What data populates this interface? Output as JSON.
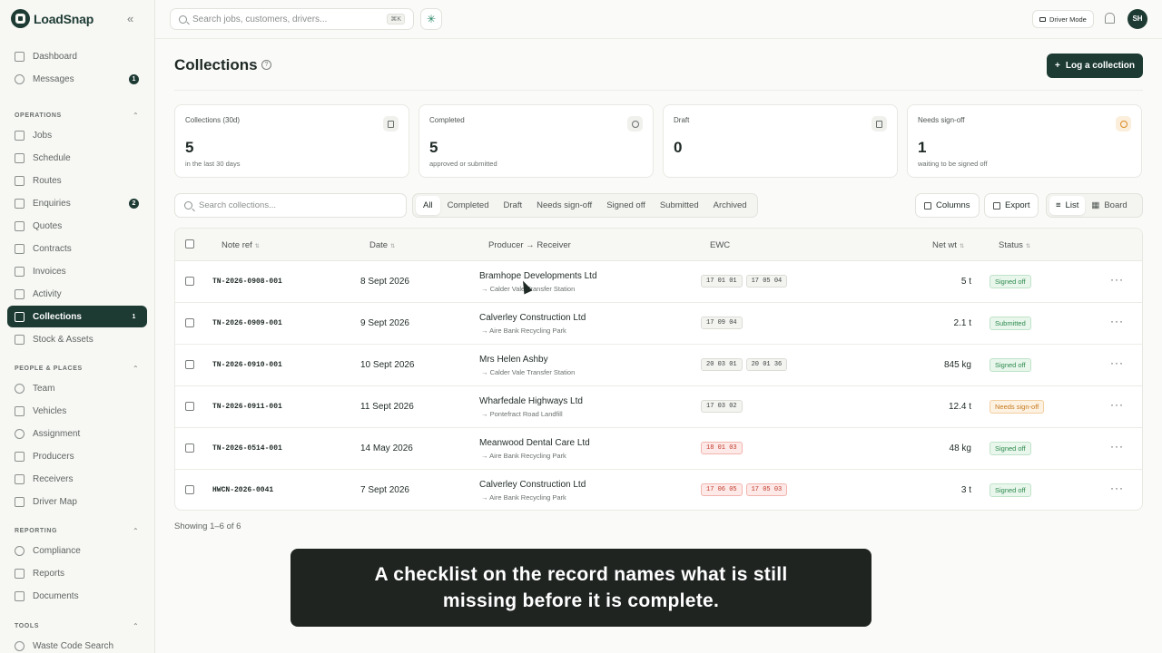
{
  "brand": {
    "name": "LoadSnap"
  },
  "sidebar": {
    "top": [
      {
        "label": "Dashboard"
      },
      {
        "label": "Messages",
        "badge": "1"
      }
    ],
    "sections": [
      {
        "title": "OPERATIONS",
        "items": [
          {
            "label": "Jobs"
          },
          {
            "label": "Schedule"
          },
          {
            "label": "Routes"
          },
          {
            "label": "Enquiries",
            "badge": "2"
          },
          {
            "label": "Quotes"
          },
          {
            "label": "Contracts"
          },
          {
            "label": "Invoices"
          },
          {
            "label": "Activity"
          },
          {
            "label": "Collections",
            "badge": "1",
            "active": true
          },
          {
            "label": "Stock & Assets"
          }
        ]
      },
      {
        "title": "PEOPLE & PLACES",
        "items": [
          {
            "label": "Team"
          },
          {
            "label": "Vehicles"
          },
          {
            "label": "Assignment"
          },
          {
            "label": "Producers"
          },
          {
            "label": "Receivers"
          },
          {
            "label": "Driver Map"
          }
        ]
      },
      {
        "title": "REPORTING",
        "items": [
          {
            "label": "Compliance"
          },
          {
            "label": "Reports"
          },
          {
            "label": "Documents"
          }
        ]
      },
      {
        "title": "TOOLS",
        "items": [
          {
            "label": "Waste Code Search"
          }
        ]
      }
    ]
  },
  "topbar": {
    "search_placeholder": "Search jobs, customers, drivers...",
    "shortcut": "⌘K",
    "driver_mode": "Driver Mode",
    "avatar": "SH"
  },
  "page": {
    "title": "Collections",
    "primary_action": "Log a collection",
    "showing": "Showing 1–6 of 6"
  },
  "stats": [
    {
      "label": "Collections (30d)",
      "value": "5",
      "sub": "in the last 30 days",
      "icon": "document-icon"
    },
    {
      "label": "Completed",
      "value": "5",
      "sub": "approved or submitted",
      "icon": "check-circle-icon"
    },
    {
      "label": "Draft",
      "value": "0",
      "sub": "",
      "icon": "document-icon"
    },
    {
      "label": "Needs sign-off",
      "value": "1",
      "sub": "waiting to be signed off",
      "icon": "clock-icon"
    }
  ],
  "toolbar": {
    "search_placeholder": "Search collections...",
    "filters": [
      "All",
      "Completed",
      "Draft",
      "Needs sign-off",
      "Signed off",
      "Submitted",
      "Archived"
    ],
    "active_filter": "All",
    "columns": "Columns",
    "export": "Export",
    "views": [
      "List",
      "Board"
    ],
    "active_view": "List"
  },
  "table": {
    "headers": {
      "ref": "Note ref",
      "date": "Date",
      "party": "Producer → Receiver",
      "ewc": "EWC",
      "netwt": "Net wt",
      "status": "Status"
    },
    "rows": [
      {
        "ref": "TN-2026-0908-001",
        "date": "8 Sept 2026",
        "producer": "Bramhope Developments Ltd",
        "receiver": "Calder Vale Transfer Station",
        "ewc": [
          {
            "code": "17 01 01"
          },
          {
            "code": "17 05 04"
          }
        ],
        "netwt": "5 t",
        "status": "Signed off",
        "status_type": "signed"
      },
      {
        "ref": "TN-2026-0909-001",
        "date": "9 Sept 2026",
        "producer": "Calverley Construction Ltd",
        "receiver": "Aire Bank Recycling Park",
        "ewc": [
          {
            "code": "17 09 04"
          }
        ],
        "netwt": "2.1 t",
        "status": "Submitted",
        "status_type": "submitted"
      },
      {
        "ref": "TN-2026-0910-001",
        "date": "10 Sept 2026",
        "producer": "Mrs Helen Ashby",
        "receiver": "Calder Vale Transfer Station",
        "ewc": [
          {
            "code": "20 03 01"
          },
          {
            "code": "20 01 36"
          }
        ],
        "netwt": "845 kg",
        "status": "Signed off",
        "status_type": "signed"
      },
      {
        "ref": "TN-2026-0911-001",
        "date": "11 Sept 2026",
        "producer": "Wharfedale Highways Ltd",
        "receiver": "Pontefract Road Landfill",
        "ewc": [
          {
            "code": "17 03 02"
          }
        ],
        "netwt": "12.4 t",
        "status": "Needs sign-off",
        "status_type": "needs"
      },
      {
        "ref": "TN-2026-0514-001",
        "date": "14 May 2026",
        "producer": "Meanwood Dental Care Ltd",
        "receiver": "Aire Bank Recycling Park",
        "ewc": [
          {
            "code": "18 01 03",
            "hazardous": true
          }
        ],
        "netwt": "48 kg",
        "status": "Signed off",
        "status_type": "signed"
      },
      {
        "ref": "HWCN-2026-0041",
        "date": "7 Sept 2026",
        "producer": "Calverley Construction Ltd",
        "receiver": "Aire Bank Recycling Park",
        "ewc": [
          {
            "code": "17 06 05",
            "hazardous": true
          },
          {
            "code": "17 05 03",
            "hazardous": true
          }
        ],
        "netwt": "3 t",
        "status": "Signed off",
        "status_type": "signed"
      }
    ]
  },
  "caption": "A checklist on the record names what is still missing before it is complete."
}
